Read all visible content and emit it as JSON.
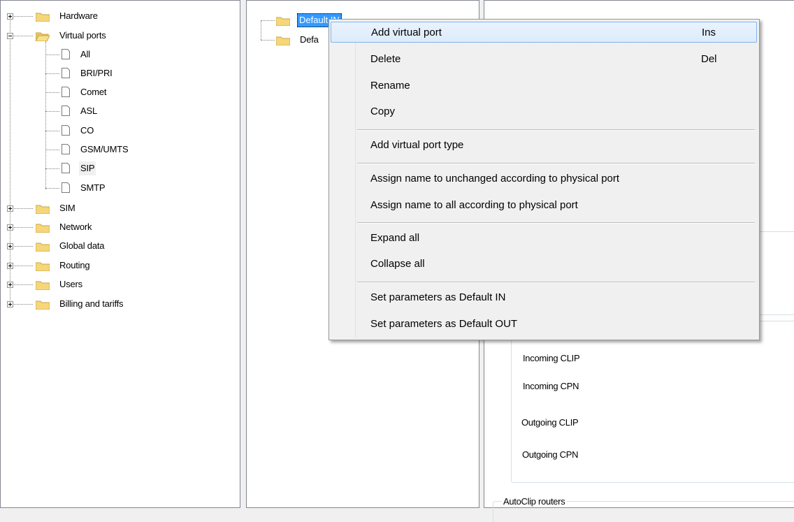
{
  "left_tree": {
    "hardware": "Hardware",
    "virtual_ports": "Virtual ports",
    "children": [
      "All",
      "BRI/PRI",
      "Comet",
      "ASL",
      "CO",
      "GSM/UMTS",
      "SIP",
      "SMTP"
    ],
    "sim": "SIM",
    "network": "Network",
    "global_data": "Global data",
    "routing": "Routing",
    "users": "Users",
    "billing": "Billing and tariffs"
  },
  "middle_tree": {
    "item1": "Default IN",
    "item2": "Defa"
  },
  "right_panel": {
    "incoming_clip": "Incoming CLIP",
    "incoming_cpn": "Incoming CPN",
    "outgoing_clip": "Outgoing CLIP",
    "outgoing_cpn": "Outgoing CPN",
    "autoclip_routers": "AutoClip routers"
  },
  "context_menu": {
    "add_virtual_port": "Add virtual port",
    "add_virtual_port_shortcut": "Ins",
    "delete": "Delete",
    "delete_shortcut": "Del",
    "rename": "Rename",
    "copy": "Copy",
    "add_virtual_port_type": "Add virtual port type",
    "assign_unchanged": "Assign name to unchanged according to physical port",
    "assign_all": "Assign name to all according to physical port",
    "expand_all": "Expand all",
    "collapse_all": "Collapse all",
    "set_default_in": "Set parameters as Default IN",
    "set_default_out": "Set parameters as Default OUT"
  },
  "colors": {
    "selection": "#3399ff",
    "folder": "#f5d77a",
    "menu_highlight_border": "#7eb4ea"
  }
}
